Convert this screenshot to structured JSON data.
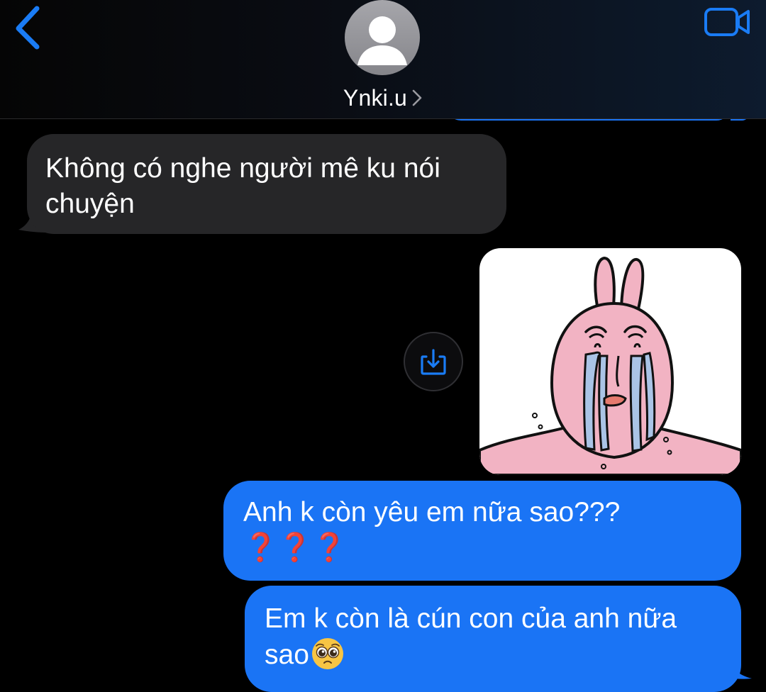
{
  "header": {
    "contact_name": "Ynki.u",
    "back_icon": "chevron-left-icon",
    "video_icon": "video-camera-icon",
    "avatar_icon": "person-silhouette-icon",
    "accent_color": "#1a74f5"
  },
  "messages": [
    {
      "direction": "received",
      "text": "Không có nghe người mê ku nói chuyện"
    },
    {
      "direction": "sent",
      "type": "sticker",
      "sticker_name": "crying-pink-rabbit-sticker"
    },
    {
      "direction": "sent",
      "text": "Anh k còn yêu em nữa sao???",
      "trailing": "❓❓❓"
    },
    {
      "direction": "sent",
      "text": "Em k còn là cún con của anh nữa sao",
      "trailing_emoji": "pleading-face-emoji"
    }
  ],
  "actions": {
    "share_icon": "share-download-icon"
  },
  "colors": {
    "received_bubble": "#262628",
    "sent_bubble": "#1a74f5",
    "background": "#000000"
  }
}
